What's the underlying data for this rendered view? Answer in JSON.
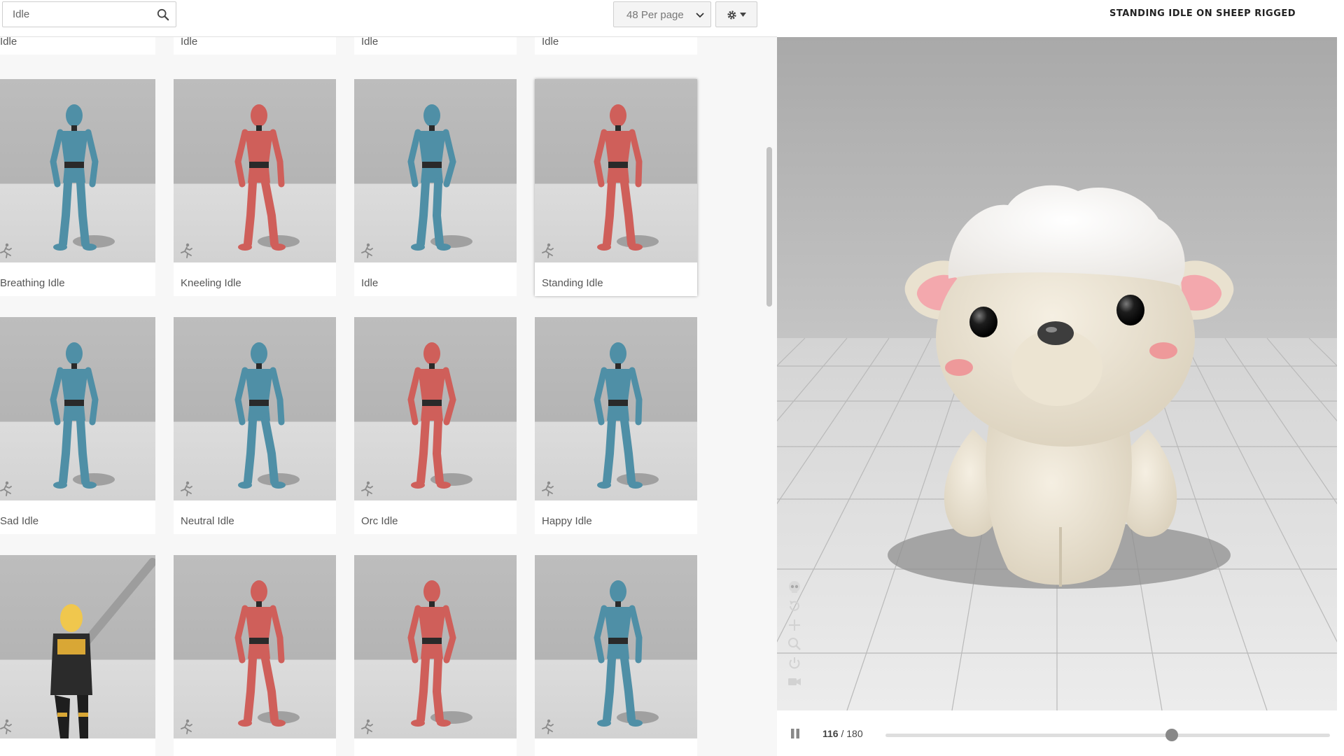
{
  "search": {
    "value": "Idle",
    "placeholder": "Search"
  },
  "toolbar": {
    "per_page": "48 Per page"
  },
  "viewer": {
    "title": "STANDING IDLE ON SHEEP RIGGED",
    "frame_current": "116",
    "frame_total": "/ 180",
    "progress": 0.644
  },
  "cards": [
    {
      "name": "Idle",
      "color": "#4f8fa6"
    },
    {
      "name": "Idle",
      "color": "#4f8fa6"
    },
    {
      "name": "Idle",
      "color": "#cf5f5a"
    },
    {
      "name": "Idle",
      "color": "#cf5f5a"
    },
    {
      "name": "Breathing Idle",
      "color": "#4f8fa6"
    },
    {
      "name": "Kneeling Idle",
      "color": "#cf5f5a"
    },
    {
      "name": "Idle",
      "color": "#4f8fa6"
    },
    {
      "name": "Standing Idle",
      "color": "#cf5f5a"
    },
    {
      "name": "Sad Idle",
      "color": "#4f8fa6"
    },
    {
      "name": "Neutral Idle",
      "color": "#4f8fa6"
    },
    {
      "name": "Orc Idle",
      "color": "#cf5f5a"
    },
    {
      "name": "Happy Idle",
      "color": "#4f8fa6"
    },
    {
      "name": "",
      "color": "#d9a735"
    },
    {
      "name": "",
      "color": "#cf5f5a"
    },
    {
      "name": "",
      "color": "#cf5f5a"
    },
    {
      "name": "",
      "color": "#4f8fa6"
    }
  ],
  "colors": {
    "blue_figure": "#4f8fa6",
    "red_figure": "#cf5f5a",
    "sheep_body": "#efe8d8",
    "sheep_wool": "#f9f6f2"
  },
  "icons": [
    "search-icon",
    "chevron-down-icon",
    "gear-icon",
    "run-icon",
    "skull-icon",
    "rotate-icon",
    "move-icon",
    "zoom-icon",
    "power-icon",
    "camera-icon",
    "pause-icon"
  ]
}
